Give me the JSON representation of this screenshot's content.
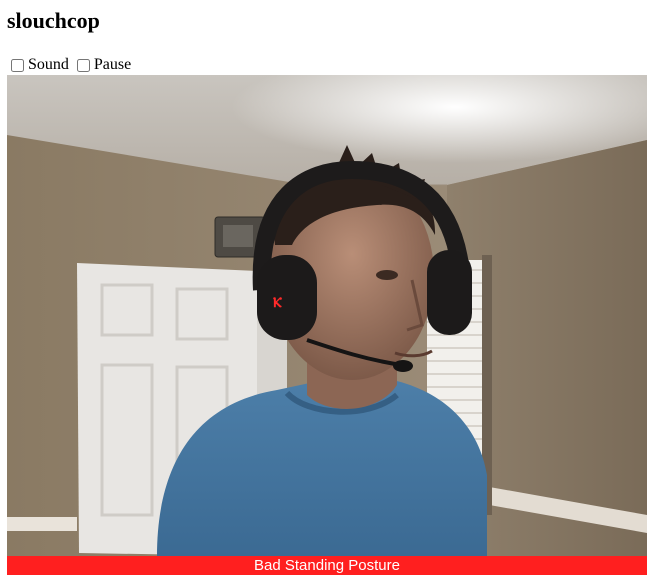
{
  "app": {
    "title": "slouchcop"
  },
  "controls": {
    "sound_label": "Sound",
    "pause_label": "Pause",
    "sound_checked": false,
    "pause_checked": false
  },
  "video": {
    "subject": "webcam-feed"
  },
  "status": {
    "text": "Bad Standing Posture",
    "color": "#ff1f1f"
  }
}
